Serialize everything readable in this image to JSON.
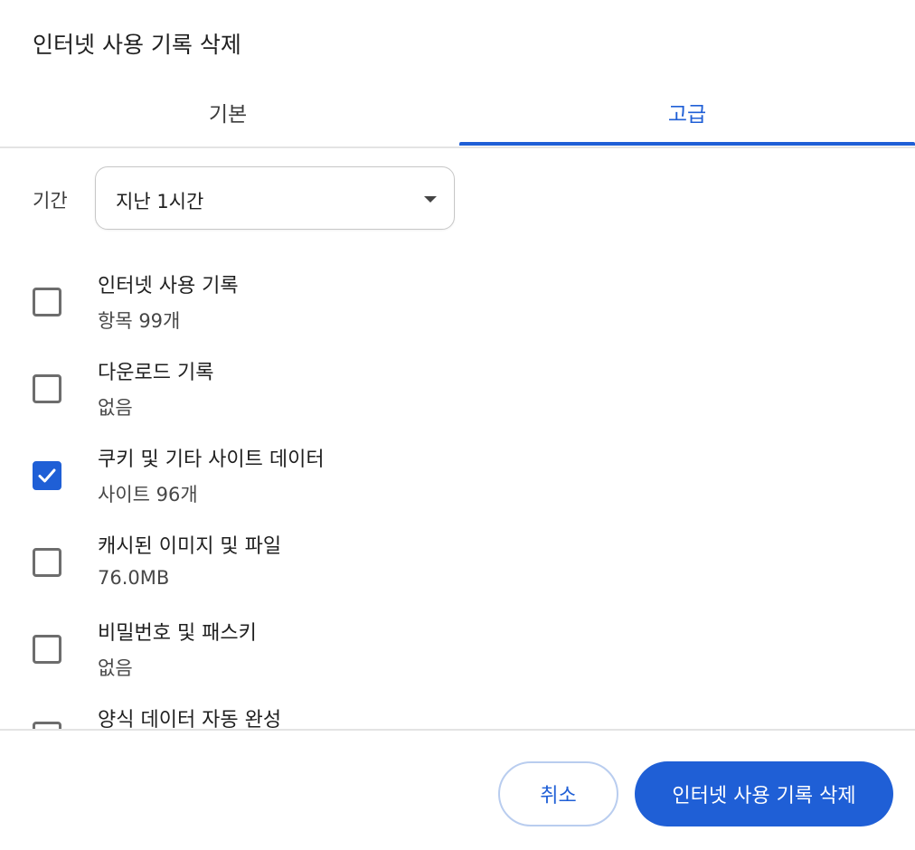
{
  "dialog": {
    "title": "인터넷 사용 기록 삭제"
  },
  "tabs": [
    {
      "label": "기본",
      "selected": false
    },
    {
      "label": "고급",
      "selected": true
    }
  ],
  "period": {
    "label": "기간",
    "value": "지난 1시간"
  },
  "items": [
    {
      "title": "인터넷 사용 기록",
      "subtitle": "항목 99개",
      "checked": false
    },
    {
      "title": "다운로드 기록",
      "subtitle": "없음",
      "checked": false
    },
    {
      "title": "쿠키 및 기타 사이트 데이터",
      "subtitle": "사이트 96개",
      "checked": true
    },
    {
      "title": "캐시된 이미지 및 파일",
      "subtitle": "76.0MB",
      "checked": false
    },
    {
      "title": "비밀번호 및 패스키",
      "subtitle": "없음",
      "checked": false
    },
    {
      "title": "양식 데이터 자동 완성",
      "subtitle": "",
      "checked": false
    }
  ],
  "buttons": {
    "cancel": "취소",
    "delete": "인터넷 사용 기록 삭제"
  },
  "colors": {
    "accent": "#1f5fd6",
    "divider": "#e3e3e3",
    "checkbox_border": "#6d6d6d"
  },
  "icons": {
    "dropdown": "caret-down-icon",
    "checked": "checkmark-icon"
  }
}
